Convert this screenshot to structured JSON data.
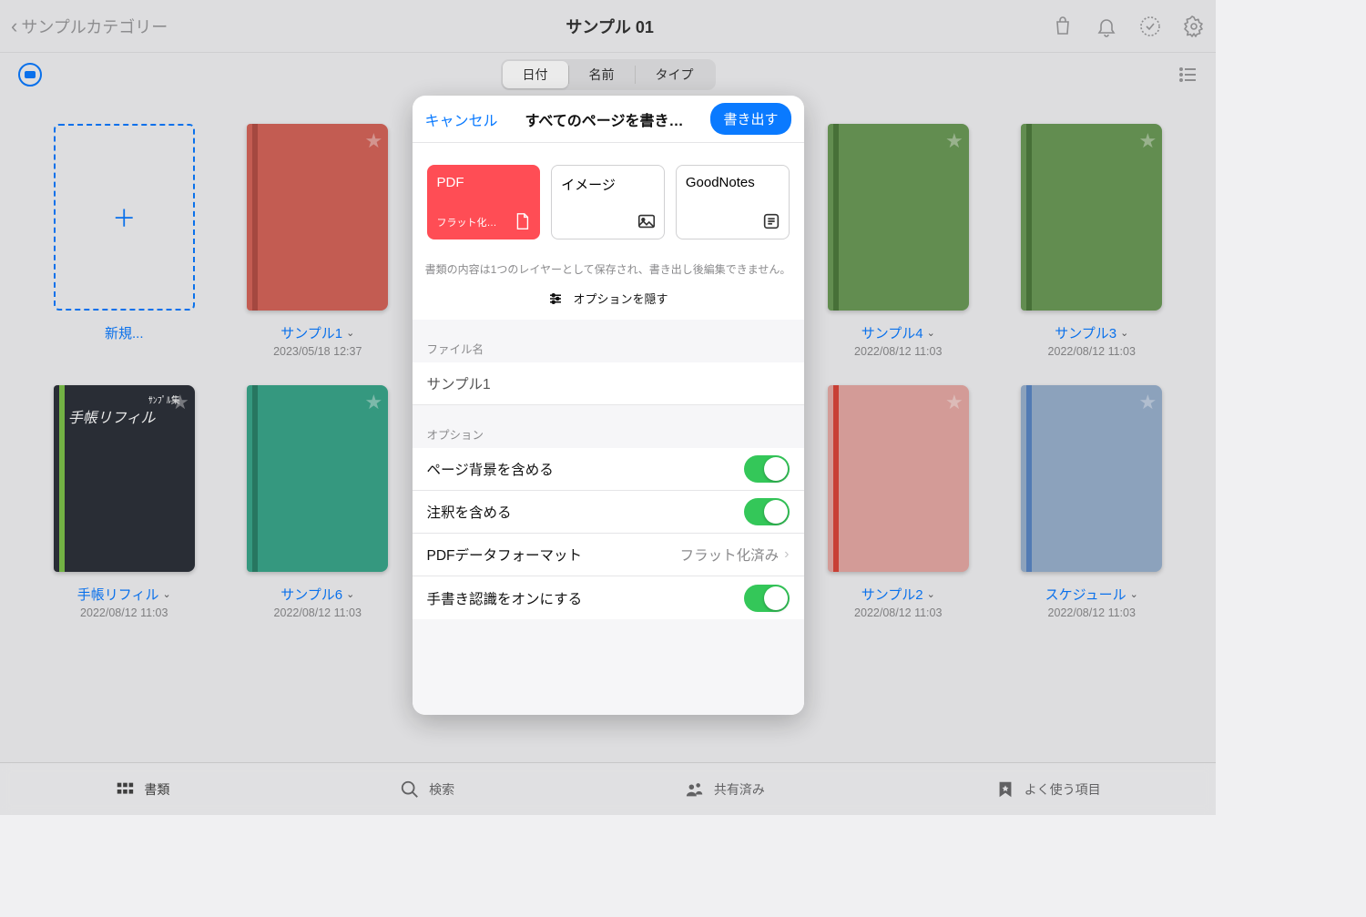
{
  "header": {
    "back_label": "サンプルカテゴリー",
    "title": "サンプル 01"
  },
  "sort": {
    "date": "日付",
    "name": "名前",
    "type": "タイプ"
  },
  "notebooks": {
    "new_label": "新規...",
    "items": [
      {
        "title": "サンプル1",
        "date": "2023/05/18 12:37",
        "cover": "#d4645a",
        "spine": "#b24f46"
      },
      {
        "title": "",
        "date": "",
        "cover": "",
        "spine": ""
      },
      {
        "title": "",
        "date": "",
        "cover": "",
        "spine": ""
      },
      {
        "title": "サンプル4",
        "date": "2022/08/12 11:03",
        "cover": "#6b9a57",
        "spine": "#4e7a3d"
      },
      {
        "title": "サンプル3",
        "date": "2022/08/12 11:03",
        "cover": "#6b9a57",
        "spine": "#4e7a3d"
      },
      {
        "title": "手帳リフィル",
        "date": "2022/08/12 11:03",
        "cover": "#2d313a",
        "spine": "#7dc24a",
        "handwriting": "手帳リフィル",
        "hand2": "ｻﾝﾌﾟﾙ集"
      },
      {
        "title": "サンプル6",
        "date": "2022/08/12 11:03",
        "cover": "#3aa58a",
        "spine": "#2b8069"
      },
      {
        "title": "",
        "date": "",
        "cover": "",
        "spine": ""
      },
      {
        "title": "",
        "date": "",
        "cover": "",
        "spine": ""
      },
      {
        "title": "サンプル2",
        "date": "2022/08/12 11:03",
        "cover": "#e5a9a4",
        "spine": "#d9453a"
      },
      {
        "title": "スケジュール",
        "date": "2022/08/12 11:03",
        "cover": "#98b0cd",
        "spine": "#5a86c4"
      }
    ]
  },
  "tabs": {
    "docs": "書類",
    "search": "検索",
    "shared": "共有済み",
    "favorites": "よく使う項目"
  },
  "modal": {
    "cancel": "キャンセル",
    "title": "すべてのページを書き…",
    "export": "書き出す",
    "formats": {
      "pdf": "PDF",
      "pdf_sub": "フラット化…",
      "image": "イメージ",
      "goodnotes": "GoodNotes"
    },
    "hint": "書類の内容は1つのレイヤーとして保存され、書き出し後編集できません。",
    "hide_options": "オプションを隠す",
    "filename_label": "ファイル名",
    "filename_value": "サンプル1",
    "options_label": "オプション",
    "opt_background": "ページ背景を含める",
    "opt_annotations": "注釈を含める",
    "opt_pdf_format": "PDFデータフォーマット",
    "opt_pdf_format_value": "フラット化済み",
    "opt_handwriting": "手書き認識をオンにする"
  }
}
